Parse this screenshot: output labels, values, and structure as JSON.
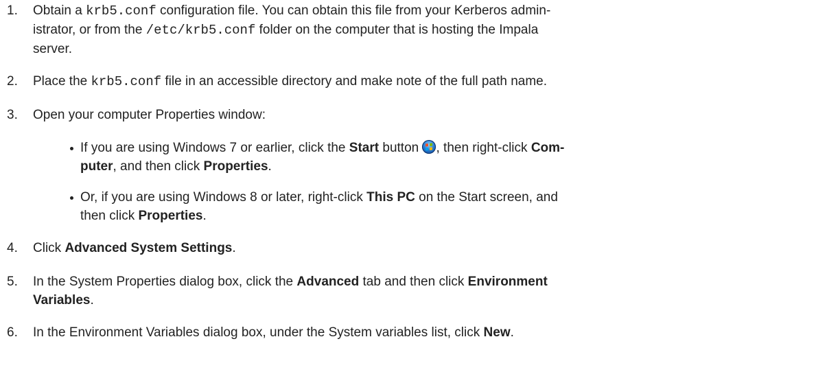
{
  "steps": [
    {
      "num": "1.",
      "p1": "Obtain a ",
      "code1": "krb5.conf",
      "p2": " configuration file. You can obtain this file from your Kerberos admin-",
      "l2a": "istrator, or from the ",
      "code2": "/etc/krb5.conf",
      "l2b": " folder on the computer that is hosting the Impala",
      "l3": "server."
    },
    {
      "num": "2.",
      "p1": "Place the ",
      "code1": "krb5.conf",
      "p2": " file in an accessible directory and make note of the full path name."
    },
    {
      "num": "3.",
      "text": "Open your computer Properties window:"
    },
    {
      "num": "4.",
      "p1": "Click ",
      "b1": "Advanced System Settings",
      "p2": "."
    },
    {
      "num": "5.",
      "p1": "In the System Properties dialog box, click the ",
      "b1": "Advanced",
      "p2": " tab and then click ",
      "b2": "Environment",
      "l2b": "Variables",
      "l2c": "."
    },
    {
      "num": "6.",
      "p1": "In the Environment Variables dialog box, under the System variables list, click ",
      "b1": "New",
      "p2": "."
    }
  ],
  "bullets": [
    {
      "p1": "If you are using Windows 7 or earlier, click the ",
      "b1": "Start",
      "p2": " button ",
      "icon": "windows-start-orb-icon",
      "p3": ", then right-click ",
      "b2": "Com-",
      "l2a": "puter",
      "l2b": ", and then click ",
      "b3": "Properties",
      "l2c": "."
    },
    {
      "p1": "Or, if you are using Windows 8 or later, right-click ",
      "b1": "This PC",
      "p2": " on the Start screen, and",
      "l2a": "then click ",
      "b2": "Properties",
      "l2b": "."
    }
  ]
}
